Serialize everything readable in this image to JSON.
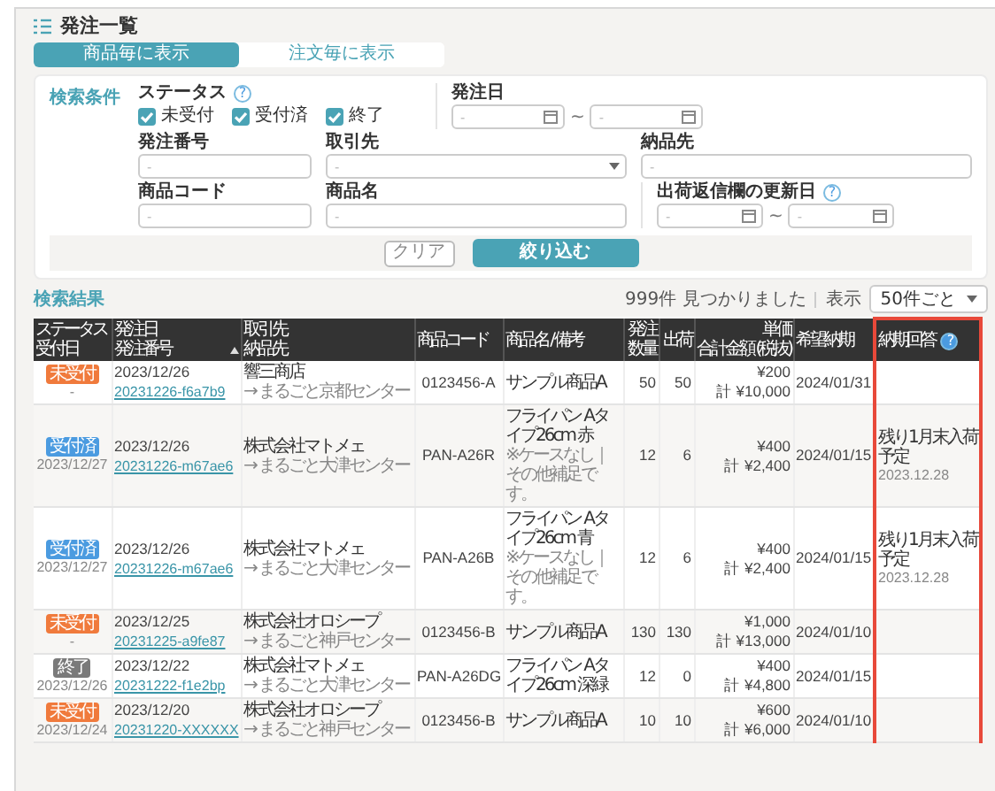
{
  "page_title": "発注一覧",
  "view_tabs": [
    {
      "label": "商品毎に表示",
      "selected": true
    },
    {
      "label": "注文毎に表示",
      "selected": false
    }
  ],
  "search": {
    "heading": "検索条件",
    "status": {
      "label": "ステータス",
      "help": "?",
      "options": [
        {
          "label": "未受付",
          "checked": true
        },
        {
          "label": "受付済",
          "checked": true
        },
        {
          "label": "終了",
          "checked": true
        }
      ]
    },
    "order_date": {
      "label": "発注日",
      "from_placeholder": "-",
      "separator": "~",
      "to_placeholder": "-"
    },
    "order_number": {
      "label": "発注番号",
      "placeholder": "-"
    },
    "partner": {
      "label": "取引先",
      "placeholder": "-"
    },
    "delivery": {
      "label": "納品先",
      "placeholder": "-"
    },
    "product_code": {
      "label": "商品コード",
      "placeholder": "-"
    },
    "product_name": {
      "label": "商品名",
      "placeholder": "-"
    },
    "update_date": {
      "label": "出荷返信欄の更新日",
      "help": "?",
      "from_placeholder": "-",
      "separator": "~",
      "to_placeholder": "-"
    },
    "clear_button": "クリア",
    "filter_button": "絞り込む"
  },
  "results": {
    "heading": "検索結果",
    "count": "999件 見つかりました",
    "display_label": "表示",
    "per_page": "50件ごと",
    "columns": [
      {
        "lines": [
          "ステータス",
          "受付日"
        ]
      },
      {
        "lines": [
          "発注日",
          "発注番号"
        ]
      },
      {
        "lines": [
          "取引先",
          "納品先"
        ]
      },
      {
        "lines": [
          "商品コード"
        ]
      },
      {
        "lines": [
          "商品名 / 備考"
        ]
      },
      {
        "lines": [
          "発注",
          "数量"
        ]
      },
      {
        "lines": [
          "出荷"
        ]
      },
      {
        "lines": [
          "単価",
          "合計金額 (税抜)"
        ]
      },
      {
        "lines": [
          "希望納期"
        ]
      },
      {
        "lines": [
          "納期回答"
        ],
        "help": "?"
      }
    ],
    "rows": [
      {
        "status": "未受付",
        "kind": "new",
        "received": "-",
        "order_date": "2023/12/26",
        "order_number": "20231226-f6a7b9",
        "partner": "響三商店",
        "delivery": "→ まるごと京都センター",
        "code": "0123456-A",
        "product": "サンプル商品A",
        "order_qty": "50",
        "ship_qty": "50",
        "unit_price": "¥200",
        "total": "計 ¥10,000",
        "desired": "2024/01/31"
      },
      {
        "status": "受付済",
        "kind": "accepted",
        "received": "2023/12/27",
        "order_date": "2023/12/26",
        "order_number": "20231226-m67ae6",
        "partner": "株式会社マトメェ",
        "delivery": "→ まるごと大津センター",
        "code": "PAN-A26R",
        "product": "フライパン Aタイプ26cm 赤",
        "remark": "※ケースなし｜その他補足です。",
        "order_qty": "12",
        "ship_qty": "6",
        "unit_price": "¥400",
        "total": "計 ¥2,400",
        "desired": "2024/01/15",
        "reply": "残り1月末入荷予定",
        "reply_date": "2023.12.28"
      },
      {
        "status": "受付済",
        "kind": "accepted",
        "received": "2023/12/27",
        "order_date": "2023/12/26",
        "order_number": "20231226-m67ae6",
        "partner": "株式会社マトメェ",
        "delivery": "→ まるごと大津センター",
        "code": "PAN-A26B",
        "product": "フライパン Aタイプ26cm 青",
        "remark": "※ケースなし｜その他補足です。",
        "order_qty": "12",
        "ship_qty": "6",
        "unit_price": "¥400",
        "total": "計 ¥2,400",
        "desired": "2024/01/15",
        "reply": "残り1月末入荷予定",
        "reply_date": "2023.12.28"
      },
      {
        "status": "未受付",
        "kind": "new",
        "received": "-",
        "order_date": "2023/12/25",
        "order_number": "20231225-a9fe87",
        "partner": "株式会社オロシープ",
        "delivery": "→ まるごと神戸センター",
        "code": "0123456-B",
        "product": "サンプル商品A",
        "order_qty": "130",
        "ship_qty": "130",
        "unit_price": "¥1,000",
        "total": "計 ¥13,000",
        "desired": "2024/01/10"
      },
      {
        "status": "終了",
        "kind": "done",
        "received": "2023/12/26",
        "order_date": "2023/12/22",
        "order_number": "20231222-f1e2bp",
        "partner": "株式会社マトメェ",
        "delivery": "→ まるごと大津センター",
        "code": "PAN-A26DG",
        "product": "フライパン Aタイプ26cm 深緑",
        "order_qty": "12",
        "ship_qty": "0",
        "unit_price": "¥400",
        "total": "計 ¥4,800",
        "desired": "2024/01/15"
      },
      {
        "status": "未受付",
        "kind": "new",
        "received": "2023/12/24",
        "order_date": "2023/12/20",
        "order_number": "20231220-XXXXXX",
        "partner": "株式会社オロシープ",
        "delivery": "→ まるごと神戸センター",
        "code": "0123456-B",
        "product": "サンプル商品A",
        "order_qty": "10",
        "ship_qty": "10",
        "unit_price": "¥600",
        "total": "計 ¥6,000",
        "desired": "2024/01/10"
      }
    ]
  }
}
